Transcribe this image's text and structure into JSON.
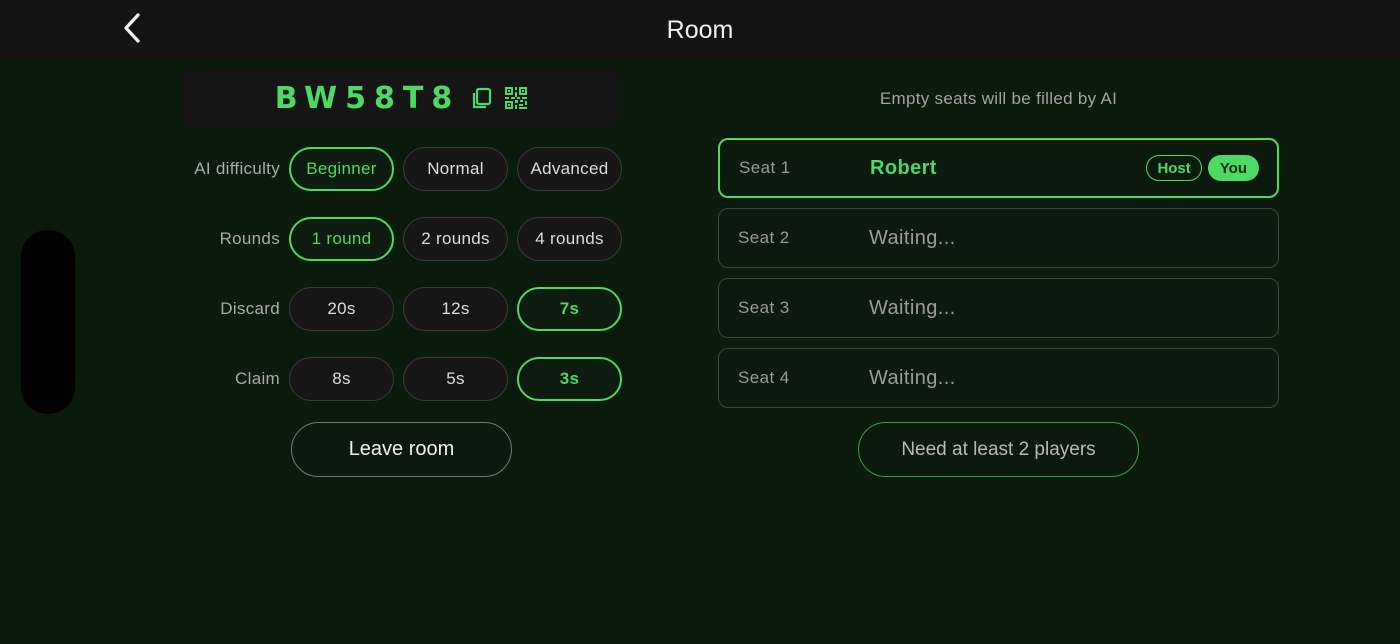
{
  "header": {
    "title": "Room",
    "back_icon": "chevron-left-icon"
  },
  "room": {
    "code": "BW58T8",
    "copy_icon": "copy-icon",
    "qr_icon": "qr-code-icon",
    "accent_color": "#4cd964"
  },
  "options": {
    "ai_difficulty": {
      "label": "AI difficulty",
      "choices": [
        "Beginner",
        "Normal",
        "Advanced"
      ],
      "selected": "Beginner"
    },
    "rounds": {
      "label": "Rounds",
      "choices": [
        "1 round",
        "2 rounds",
        "4 rounds"
      ],
      "selected": "1 round"
    },
    "discard": {
      "label": "Discard",
      "choices": [
        "20s",
        "12s",
        "7s"
      ],
      "selected": "7s"
    },
    "claim": {
      "label": "Claim",
      "choices": [
        "8s",
        "5s",
        "3s"
      ],
      "selected": "3s"
    }
  },
  "leave_button": "Leave room",
  "seats_info": "Empty seats will be filled by AI",
  "seats": [
    {
      "label": "Seat 1",
      "name": "Robert",
      "badges": [
        "Host",
        "You"
      ]
    },
    {
      "label": "Seat 2",
      "name": "Waiting..."
    },
    {
      "label": "Seat 3",
      "name": "Waiting..."
    },
    {
      "label": "Seat 4",
      "name": "Waiting..."
    }
  ],
  "start_button": "Need at least 2 players"
}
